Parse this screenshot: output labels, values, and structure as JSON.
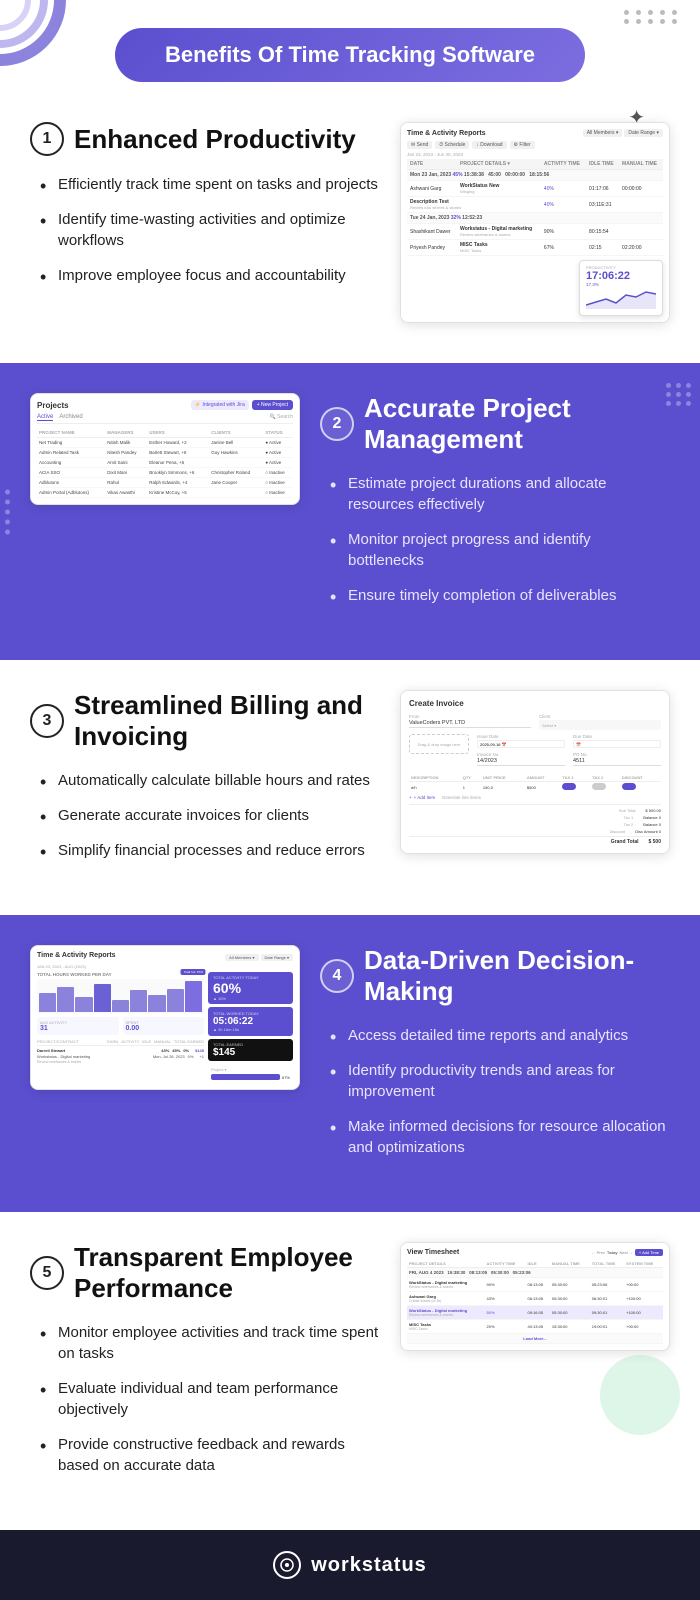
{
  "header": {
    "title": "Benefits Of Time Tracking Software",
    "dots_count": 10
  },
  "section1": {
    "number": "1",
    "heading": "Enhanced Productivity",
    "bullets": [
      "Efficiently track time spent on tasks and projects",
      "Identify time-wasting activities and optimize workflows",
      "Improve employee focus and accountability"
    ],
    "mockup_title": "Time & Activity Reports",
    "productivity_label": "PRODUCTIVITY",
    "productivity_value": "17:06:22",
    "productivity_pct": "17.3%"
  },
  "section2": {
    "number": "2",
    "heading": "Accurate Project Management",
    "bullets": [
      "Estimate project durations and allocate resources effectively",
      "Monitor project progress and identify bottlenecks",
      "Ensure timely completion of deliverables"
    ],
    "mockup_title": "Projects",
    "tab_active": "Active",
    "tab_inactive": "Archived",
    "new_btn": "+ New Project"
  },
  "section3": {
    "number": "3",
    "heading": "Streamlined Billing and Invoicing",
    "bullets": [
      "Automatically calculate billable hours and rates",
      "Generate accurate invoices for clients",
      "Simplify financial processes and reduce errors"
    ],
    "mockup_title": "Create Invoice",
    "from_label": "From",
    "from_value": "ValueCoders PVT. LTD",
    "logo_placeholder": "Drag & drop image here",
    "add_item": "+ Add Item",
    "generate": "Generate line items",
    "total_label": "TOTAL",
    "total_value": "$ 500"
  },
  "section4": {
    "number": "4",
    "heading": "Data-Driven Decision-Making",
    "bullets": [
      "Access detailed time reports and analytics",
      "Identify productivity trends and areas for improvement",
      "Make informed decisions for resource allocation and optimizations"
    ],
    "mockup_title": "Time & Activity Reports",
    "total_hours_label": "TOTAL HOURS WORKED PER DAY",
    "total_pct": "60%",
    "avg_label": "AVG ACTIVITY",
    "avg_value": "31",
    "spent_label": "SPENT",
    "spent_value": "0.00",
    "activity_today_label": "TOTAL ACTIVITY TODAY",
    "activity_today_pct": "60%",
    "worked_today_label": "TOTAL WORKED TODAY",
    "worked_today_value": "05:06:22",
    "earned_label": "TOTAL EARNED",
    "earned_value": "$145"
  },
  "section5": {
    "number": "5",
    "heading": "Transparent Employee Performance",
    "bullets": [
      "Monitor employee activities and track time spent on tasks",
      "Evaluate individual and team performance objectively",
      "Provide constructive feedback and rewards based on accurate data"
    ],
    "mockup_title": "View Timesheet",
    "view_btn": "+ Add Time"
  },
  "footer": {
    "brand": "workstatus"
  }
}
